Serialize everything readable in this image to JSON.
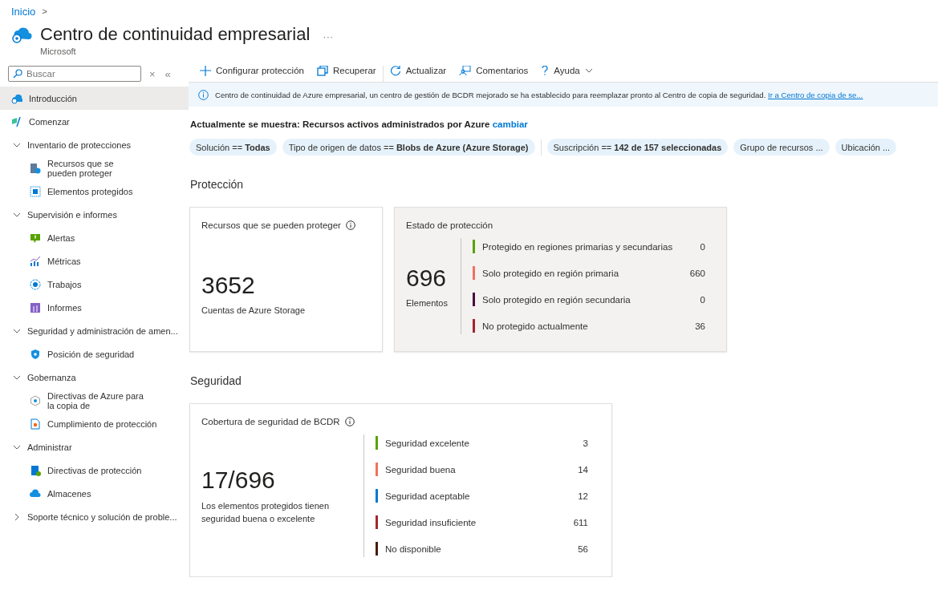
{
  "breadcrumb": {
    "label": "Inicio",
    "separator": ">"
  },
  "header": {
    "title": "Centro de continuidad empresarial",
    "more": "···",
    "subtitle": "Microsoft"
  },
  "sidebar": {
    "search": {
      "placeholder": "Buscar"
    },
    "clear": "×",
    "collapse": "«",
    "items": [
      {
        "label": "Introducción",
        "selected": true
      },
      {
        "label": "Comenzar",
        "selected": false
      },
      {
        "label": "Inventario de protecciones",
        "expanded": true,
        "children": [
          {
            "label": "Recursos que se pueden proteger",
            "selected": false
          },
          {
            "label": "Elementos protegidos",
            "selected": false
          }
        ]
      },
      {
        "label": "Supervisión e informes",
        "expanded": true,
        "children": [
          {
            "label": "Alertas",
            "selected": false
          },
          {
            "label": "Métricas",
            "selected": false
          },
          {
            "label": "Trabajos",
            "selected": false
          },
          {
            "label": "Informes",
            "selected": false
          }
        ]
      },
      {
        "label": "Seguridad y administración de amen...",
        "expanded": true,
        "children": [
          {
            "label": "Posición de seguridad",
            "selected": false
          }
        ]
      },
      {
        "label": "Gobernanza",
        "expanded": true,
        "children": [
          {
            "label": "Directivas de Azure para la copia de",
            "selected": false
          },
          {
            "label": "Cumplimiento de protección",
            "selected": false
          }
        ]
      },
      {
        "label": "Administrar",
        "expanded": true,
        "children": [
          {
            "label": "Directivas de protección",
            "selected": false
          },
          {
            "label": "Almacenes",
            "selected": false
          }
        ]
      },
      {
        "label": "Soporte técnico y solución de proble...",
        "expanded": false
      }
    ]
  },
  "toolbar": [
    {
      "label": "Configurar protección",
      "kind": "plus"
    },
    {
      "label": "Recuperar",
      "kind": "copy"
    },
    {
      "label": "Actualizar",
      "kind": "refresh"
    },
    {
      "label": "Comentarios",
      "kind": "feedback"
    },
    {
      "label": "Ayuda",
      "kind": "help"
    }
  ],
  "banner": {
    "text": "Centro de continuidad de Azure empresarial, un centro de gestión de BCDR mejorado se ha establecido para reemplazar pronto al Centro de copia de seguridad.",
    "link": "Ir a Centro de copia de se..."
  },
  "scope": {
    "text": "Actualmente se muestra: Recursos activos administrados por Azure",
    "link": "cambiar"
  },
  "filters": [
    {
      "label": "Solución == **Todas**"
    },
    {
      "label": "Tipo de origen de datos == **Blobs de Azure (Azure Storage)**"
    },
    {
      "label": "Suscripción == **142 de 157 seleccionadas**"
    },
    {
      "label": "Grupo de recursos ..."
    },
    {
      "label": "Ubicación ..."
    }
  ],
  "sections": [
    {
      "title": "Protección",
      "cards": [
        {
          "kind": "stat",
          "title": "Recursos que se pueden proteger",
          "info": true,
          "value": "3652",
          "caption": "Cuentas de Azure Storage"
        },
        {
          "kind": "legend",
          "title": "Estado de protección",
          "value": "696",
          "caption": "Elementos",
          "legend": [
            {
              "label": "Protegido en regiones primarias y secundarias",
              "value": "0",
              "color": "#57a300"
            },
            {
              "label": "Solo protegido en región primaria",
              "value": "660",
              "color": "#f1715b"
            },
            {
              "label": "Solo protegido en región secundaria",
              "value": "0",
              "color": "#4b0a43"
            },
            {
              "label": "No protegido actualmente",
              "value": "36",
              "color": "#a4262c"
            }
          ]
        }
      ]
    },
    {
      "title": "Seguridad",
      "cards": [
        {
          "kind": "legend",
          "title": "Cobertura de seguridad de BCDR",
          "info": true,
          "value": "17/696",
          "caption": "Los elementos protegidos tienen seguridad buena o excelente",
          "legend": [
            {
              "label": "Seguridad excelente",
              "value": "3",
              "color": "#57a300"
            },
            {
              "label": "Seguridad buena",
              "value": "14",
              "color": "#f1715b"
            },
            {
              "label": "Seguridad aceptable",
              "value": "12",
              "color": "#0078d4"
            },
            {
              "label": "Seguridad insuficiente",
              "value": "611",
              "color": "#a4262c"
            },
            {
              "label": "No disponible",
              "value": "56",
              "color": "#4a1a05"
            }
          ]
        }
      ]
    }
  ]
}
